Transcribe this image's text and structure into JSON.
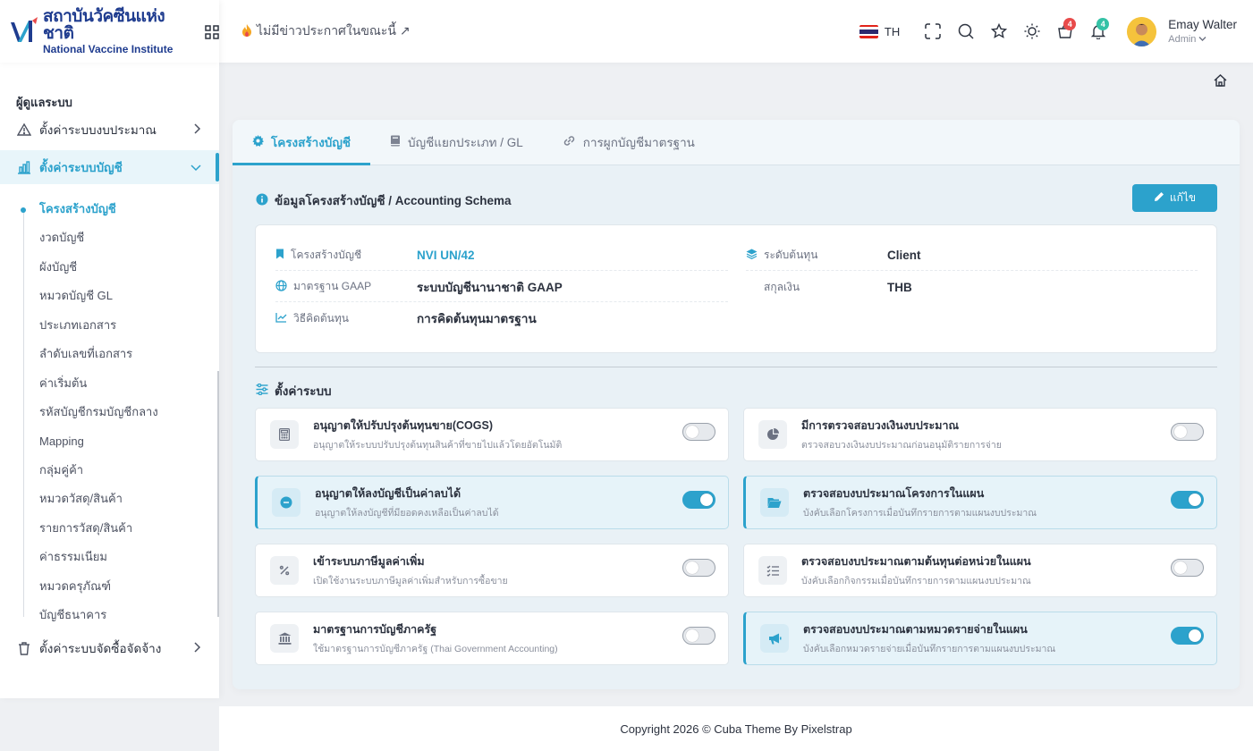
{
  "brand": {
    "name_th": "สถาบันวัคซีนแห่งชาติ",
    "name_en": "National Vaccine Institute"
  },
  "header": {
    "announcement": "ไม่มีข่าวประกาศในขณะนี้ ↗",
    "language": "TH",
    "cart_badge": "4",
    "notification_badge": "4",
    "user_name": "Emay Walter",
    "user_role": "Admin"
  },
  "sidebar": {
    "section": "ผู้ดูแลระบบ",
    "menu": [
      {
        "label": "ตั้งค่าระบบงบประมาณ",
        "icon": "warning-icon"
      },
      {
        "label": "ตั้งค่าระบบบัญชี",
        "icon": "chart-icon"
      },
      {
        "label": "ตั้งค่าระบบจัดซื้อจัดจ้าง",
        "icon": "trash-icon"
      }
    ],
    "submenu": [
      "โครงสร้างบัญชี",
      "งวดบัญชี",
      "ผังบัญชี",
      "หมวดบัญชี GL",
      "ประเภทเอกสาร",
      "ลำดับเลขที่เอกสาร",
      "ค่าเริ่มต้น",
      "รหัสบัญชีกรมบัญชีกลาง",
      "Mapping",
      "กลุ่มคู่ค้า",
      "หมวดวัสดุ/สินค้า",
      "รายการวัสดุ/สินค้า",
      "ค่าธรรมเนียม",
      "หมวดครุภัณฑ์",
      "บัญชีธนาคาร"
    ]
  },
  "tabs": [
    {
      "label": "โครงสร้างบัญชี",
      "icon": "gear-icon"
    },
    {
      "label": "บัญชีแยกประเภท / GL",
      "icon": "book-icon"
    },
    {
      "label": "การผูกบัญชีมาตรฐาน",
      "icon": "link-icon"
    }
  ],
  "schema": {
    "title": "ข้อมูลโครงสร้างบัญชี / Accounting Schema",
    "edit_label": "แก้ไข",
    "fields": [
      {
        "label": "โครงสร้างบัญชี",
        "value": "NVI UN/42"
      },
      {
        "label": "มาตรฐาน GAAP",
        "value": "ระบบบัญชีนานาชาติ GAAP"
      },
      {
        "label": "วิธีคิดต้นทุน",
        "value": "การคิดต้นทุนมาตรฐาน"
      },
      {
        "label": "ระดับต้นทุน",
        "value": "Client"
      },
      {
        "label": "สกุลเงิน",
        "value": "THB"
      }
    ]
  },
  "settings": {
    "title": "ตั้งค่าระบบ",
    "items": [
      {
        "title": "อนุญาตให้ปรับปรุงต้นทุนขาย(COGS)",
        "desc": "อนุญาตให้ระบบปรับปรุงต้นทุนสินค้าที่ขายไปแล้วโดยอัตโนมัติ",
        "enabled": false,
        "icon": "calculator-icon"
      },
      {
        "title": "มีการตรวจสอบวงเงินงบประมาณ",
        "desc": "ตรวจสอบวงเงินงบประมาณก่อนอนุมัติรายการจ่าย",
        "enabled": false,
        "icon": "pie-chart-icon"
      },
      {
        "title": "อนุญาตให้ลงบัญชีเป็นค่าลบได้",
        "desc": "อนุญาตให้ลงบัญชีที่มียอดคงเหลือเป็นค่าลบได้",
        "enabled": true,
        "icon": "minus-circle-icon"
      },
      {
        "title": "ตรวจสอบงบประมาณโครงการในแผน",
        "desc": "บังคับเลือกโครงการเมื่อบันทึกรายการตามแผนงบประมาณ",
        "enabled": true,
        "icon": "folder-icon"
      },
      {
        "title": "เข้าระบบภาษีมูลค่าเพิ่ม",
        "desc": "เปิดใช้งานระบบภาษีมูลค่าเพิ่มสำหรับการซื้อขาย",
        "enabled": false,
        "icon": "percent-icon"
      },
      {
        "title": "ตรวจสอบงบประมาณตามต้นทุนต่อหน่วยในแผน",
        "desc": "บังคับเลือกกิจกรรมเมื่อบันทึกรายการตามแผนงบประมาณ",
        "enabled": false,
        "icon": "checklist-icon"
      },
      {
        "title": "มาตรฐานการบัญชีภาครัฐ",
        "desc": "ใช้มาตรฐานการบัญชีภาครัฐ (Thai Government Accounting)",
        "enabled": false,
        "icon": "bank-icon"
      },
      {
        "title": "ตรวจสอบงบประมาณตามหมวดรายจ่ายในแผน",
        "desc": "บังคับเลือกหมวดรายจ่ายเมื่อบันทึกรายการตามแผนงบประมาณ",
        "enabled": true,
        "icon": "megaphone-icon"
      }
    ]
  },
  "footer": {
    "copyright": "Copyright 2026 © Cuba Theme By Pixelstrap"
  },
  "colors": {
    "accent": "#2ca2cc",
    "brand": "#1f3c8f",
    "badge_red": "#e84b4b",
    "badge_teal": "#35c2a6"
  }
}
